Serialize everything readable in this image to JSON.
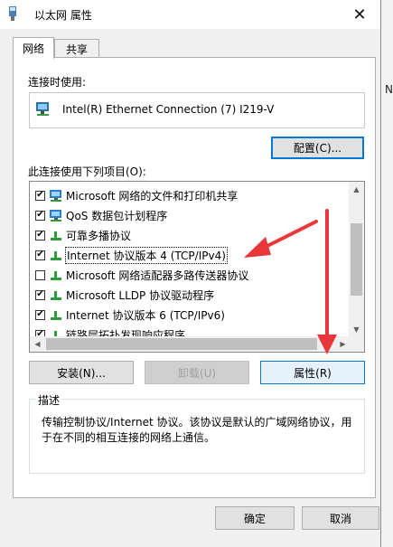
{
  "window": {
    "title": "以太网 属性",
    "close_glyph": "✕"
  },
  "tabs": [
    {
      "label": "网络",
      "active": true
    },
    {
      "label": "共享",
      "active": false
    }
  ],
  "connect_using": {
    "label": "连接时使用:",
    "adapter_name": "Intel(R) Ethernet Connection (7) I219-V",
    "configure_button": "配置(C)..."
  },
  "items_section": {
    "label": "此连接使用下列项目(O):",
    "items": [
      {
        "label": "Microsoft 网络的文件和打印机共享",
        "checked": true,
        "icon": "network-monitor-icon",
        "selected": false
      },
      {
        "label": "QoS 数据包计划程序",
        "checked": true,
        "icon": "network-monitor-icon",
        "selected": false
      },
      {
        "label": "可靠多播协议",
        "checked": true,
        "icon": "protocol-icon",
        "selected": false
      },
      {
        "label": "Internet 协议版本 4 (TCP/IPv4)",
        "checked": true,
        "icon": "protocol-icon",
        "selected": true
      },
      {
        "label": "Microsoft 网络适配器多路传送器协议",
        "checked": false,
        "icon": "protocol-icon",
        "selected": false
      },
      {
        "label": "Microsoft LLDP 协议驱动程序",
        "checked": true,
        "icon": "protocol-icon",
        "selected": false
      },
      {
        "label": "Internet 协议版本 6 (TCP/IPv6)",
        "checked": true,
        "icon": "protocol-icon",
        "selected": false
      },
      {
        "label": "链路层拓扑发现响应程序",
        "checked": true,
        "icon": "protocol-icon",
        "selected": false
      }
    ]
  },
  "action_buttons": {
    "install": "安装(N)...",
    "uninstall": "卸载(U)",
    "properties": "属性(R)"
  },
  "description": {
    "title": "描述",
    "text": "传输控制协议/Internet 协议。该协议是默认的广域网络协议，用于在不同的相互连接的网络上通信。"
  },
  "footer": {
    "ok": "确定",
    "cancel": "取消"
  },
  "colors": {
    "accent": "#0078d7",
    "annotation_arrow": "#e8373a"
  }
}
